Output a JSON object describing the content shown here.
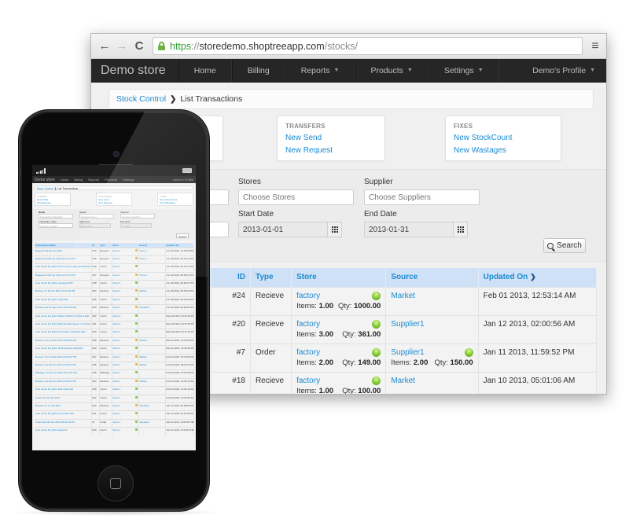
{
  "browser": {
    "url": {
      "scheme": "https",
      "separator": "://",
      "host": "storedemo.shoptreeapp.com",
      "path": "/stocks/"
    },
    "nav": {
      "back_icon": "arrow-left",
      "forward_icon": "arrow-right",
      "reload_icon": "reload",
      "menu_icon": "hamburger"
    }
  },
  "navbar": {
    "brand": "Demo store",
    "items": [
      {
        "label": "Home",
        "dropdown": false
      },
      {
        "label": "Billing",
        "dropdown": false
      },
      {
        "label": "Reports",
        "dropdown": true
      },
      {
        "label": "Products",
        "dropdown": true
      },
      {
        "label": "Settings",
        "dropdown": true
      }
    ],
    "profile": "Demo's Profile"
  },
  "breadcrumb": {
    "parent": "Stock Control",
    "current": "List Transactions"
  },
  "action_boxes": [
    {
      "title": "ORDERS",
      "links": [
        "New Order",
        "New Receive"
      ]
    },
    {
      "title": "TRANSFERS",
      "links": [
        "New Send",
        "New Request"
      ]
    },
    {
      "title": "FIXES",
      "links": [
        "New StockCount",
        "New Wastages"
      ]
    }
  ],
  "filters": {
    "name": {
      "label": "Name",
      "placeholder": "Transaction Name/ID"
    },
    "transaction_type": {
      "label": "Transaction Type",
      "placeholder": "Choose Sections"
    },
    "stores": {
      "label": "Stores",
      "placeholder": "Choose Stores"
    },
    "supplier": {
      "label": "Supplier",
      "placeholder": "Choose Suppliers"
    },
    "start_date": {
      "label": "Start Date",
      "value": "2013-01-01",
      "phone_placeholder": "From Date"
    },
    "end_date": {
      "label": "End Date",
      "value": "2013-01-31",
      "phone_placeholder": "To Date"
    },
    "search_label": "Search"
  },
  "table": {
    "headers": {
      "name": "Transaction Name",
      "id": "ID",
      "type": "Type",
      "store": "Store",
      "source": "Source",
      "updated": "Updated On"
    },
    "rows": [
      {
        "name_tail": "7 PM",
        "id": "#24",
        "type": "Recieve",
        "store": "factory",
        "store_items": "1.00",
        "store_qty": "1000.00",
        "source": "Market",
        "source_items": null,
        "source_qty": null,
        "updated": "Feb 01 2013, 12:53:14 AM"
      },
      {
        "name_tail": "",
        "id": "#20",
        "type": "Recieve",
        "store": "factory",
        "store_items": "3.00",
        "store_qty": "361.00",
        "source": "Supplier1",
        "source_items": null,
        "source_qty": null,
        "updated": "Jan 12 2013, 02:00:56 AM"
      },
      {
        "name_tail": "PM",
        "id": "#7",
        "type": "Order",
        "store": "factory",
        "store_items": "2.00",
        "store_qty": "149.00",
        "source": "Supplier1",
        "source_items": "2.00",
        "source_qty": "150.00",
        "updated": "Jan 11 2013, 11:59:52 PM"
      },
      {
        "name_tail": "4 PM",
        "id": "#18",
        "type": "Recieve",
        "store": "factory",
        "store_items": "1.00",
        "store_qty": "100.00",
        "source": "Market",
        "source_items": null,
        "source_qty": null,
        "updated": "Jan 10 2013, 05:01:06 AM"
      }
    ],
    "items_label": "Items:",
    "qty_label": "Qty:"
  },
  "phone": {
    "rows": [
      {
        "name": "Request Sat 29 Jun 2013",
        "id": "#40",
        "type": "Request",
        "store": "Store 2",
        "source": "Store 1",
        "updated": "Jun 29 2013, 10:03:25 PM"
      },
      {
        "name": "Request Fri 28 Jun 2013 12:27:42 PM",
        "id": "#36",
        "type": "Request",
        "store": "Store 2",
        "source": "Store 1",
        "updated": "Jun 28 2013, 06:51:12 PM"
      },
      {
        "name": "Auto Count Fix @For Amul Cheese Spread 200GM #36",
        "id": "#39",
        "type": "Count",
        "store": "Store 2",
        "source": "",
        "updated": "Jun 28 2013, 06:01:47 PM"
      },
      {
        "name": "Request Fri 28 Jun 2013 12:27:56 PM",
        "id": "#37",
        "type": "Request",
        "store": "Store 2",
        "source": "Store 1",
        "updated": "Jun 28 2013, 06:00:16 PM"
      },
      {
        "name": "Auto Count Fix @For pineapple #37",
        "id": "#38",
        "type": "Count",
        "store": "Store 2",
        "source": "",
        "updated": "Jun 28 2013, 06:00:07 PM"
      },
      {
        "name": "Recieve Fri 28 Jun 2013 12:12:35 PM",
        "id": "#34",
        "type": "Recieve",
        "store": "Store 2",
        "source": "Market",
        "updated": "Jun 28 2013, 05:45:04 PM"
      },
      {
        "name": "Auto Count Fix @For cake #36",
        "id": "#35",
        "type": "Count",
        "store": "Store 2",
        "source": "",
        "updated": "Jun 28 2013, 05:42:02 PM"
      },
      {
        "name": "Recieve Sat 18 May 2013 05:03:26 AM",
        "id": "#33",
        "type": "Recieve",
        "store": "Store 1",
        "source": "Supplier1",
        "updated": "Jun 20 2013, 02:26:51 PM"
      },
      {
        "name": "Auto Count Fix @For Butter 100GM in Product Edit",
        "id": "#32",
        "type": "Count",
        "store": "Store 2",
        "source": "",
        "updated": "May 18 2013, 02:32:20 PM"
      },
      {
        "name": "Auto Count Fix @For Basmati Rice Super in Product Edit",
        "id": "#31",
        "type": "Count",
        "store": "Store 2",
        "source": "",
        "updated": "May 18 2013, 02:31:55 PM"
      },
      {
        "name": "Auto Count Fix @For Ice Cream in Product Edit",
        "id": "#30",
        "type": "Count",
        "store": "Store 1",
        "source": "",
        "updated": "May 18 2013, 02:12:15 PM"
      },
      {
        "name": "Recieve Tue 12 Mar 2013 06:08:41 AM",
        "id": "#28",
        "type": "Recieve",
        "store": "Store 1",
        "source": "Market",
        "updated": "Mar 12 2013, 01:39:53 PM"
      },
      {
        "name": "Auto Count Fix @For Dark Fantasy 100g #29",
        "id": "#29",
        "type": "Count",
        "store": "Store 1",
        "source": "",
        "updated": "Mar 12 2013, 01:39:36 PM"
      },
      {
        "name": "Recieve Thu 21 Feb 2013 02:02:27 PM",
        "id": "#27",
        "type": "Recieve",
        "store": "Store 1",
        "source": "Market",
        "updated": "Feb 21 2013, 07:33:00 PM"
      },
      {
        "name": "Recieve Tue 29 Jan 2013 01:38:47 PM",
        "id": "#25",
        "type": "Recieve",
        "store": "Store 1",
        "source": "Market",
        "updated": "Feb 01 2013, 05:07:37 PM"
      },
      {
        "name": "Wastage Thu 31 Jan 2013 07:16:01 PM",
        "id": "#26",
        "type": "Wastage",
        "store": "Store 1",
        "source": "",
        "updated": "Feb 01 2013, 07:02:29 PM"
      },
      {
        "name": "Recieve Tue 29 Jan 2013 01:38:47 PM",
        "id": "#24",
        "type": "Recieve",
        "store": "Store 1",
        "source": "Market",
        "updated": "Feb 01 2013, 12:53:14 AM"
      },
      {
        "name": "Auto Count Fix @For Diet Coke #24",
        "id": "#26",
        "type": "Count",
        "store": "Store 1",
        "source": "",
        "updated": "Feb 01 2013, 12:02:19 AM"
      },
      {
        "name": "Count Tue 15 Jan 2013",
        "id": "#22",
        "type": "Count",
        "store": "Store 1",
        "source": "",
        "updated": "Feb 01 2013, 12:01:56 AM"
      },
      {
        "name": "Recieve Fri 11 Jan 2013",
        "id": "#20",
        "type": "Recieve",
        "store": "Store 1",
        "source": "Supplier1",
        "updated": "Jan 12 2013, 02:00:56 AM"
      },
      {
        "name": "Auto Count Fix @For Ice Cream #20",
        "id": "#21",
        "type": "Count",
        "store": "Store 1",
        "source": "",
        "updated": "Jan 12 2013, 01:57:25 AM"
      },
      {
        "name": "Order Wed 09 Jan 2013 08:41:30 PM",
        "id": "#7",
        "type": "Order",
        "store": "Store 1",
        "source": "Supplier1",
        "updated": "Jan 11 2013, 11:59:52 PM"
      },
      {
        "name": "Auto Count Fix @For Apple #7",
        "id": "#19",
        "type": "Count",
        "store": "Store 1",
        "source": "",
        "updated": "Jan 11 2013, 11:20:51 PM"
      }
    ]
  }
}
